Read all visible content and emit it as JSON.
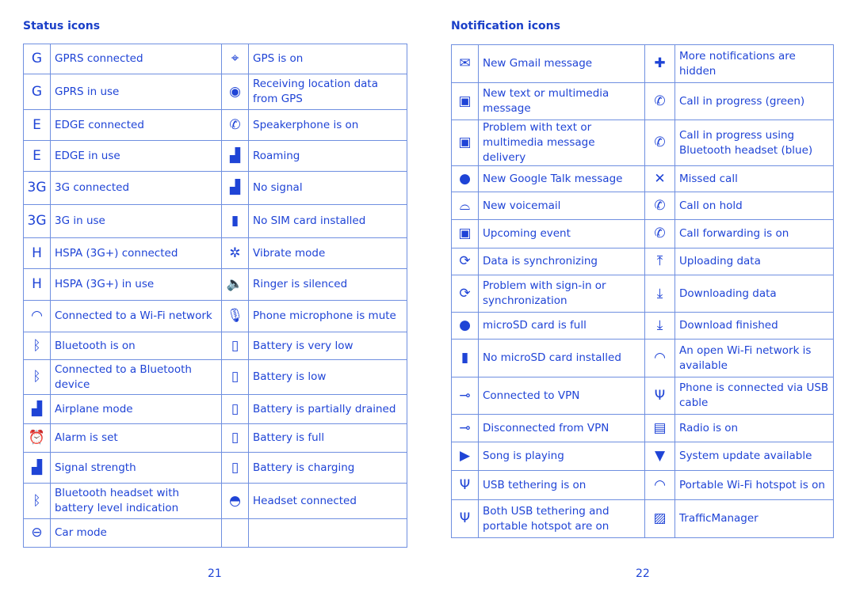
{
  "left": {
    "heading": "Status icons",
    "page": "21",
    "rows": [
      [
        {
          "icon": "gprs-connected-icon",
          "label": "GPRS connected"
        },
        {
          "icon": "gps-on-icon",
          "label": "GPS is on"
        }
      ],
      [
        {
          "icon": "gprs-in-use-icon",
          "label": "GPRS in use"
        },
        {
          "icon": "gps-receiving-icon",
          "label": "Receiving location data from GPS"
        }
      ],
      [
        {
          "icon": "edge-connected-icon",
          "label": "EDGE connected"
        },
        {
          "icon": "speakerphone-icon",
          "label": "Speakerphone is on"
        }
      ],
      [
        {
          "icon": "edge-in-use-icon",
          "label": "EDGE in use"
        },
        {
          "icon": "roaming-icon",
          "label": "Roaming"
        }
      ],
      [
        {
          "icon": "3g-connected-icon",
          "label": "3G connected"
        },
        {
          "icon": "no-signal-icon",
          "label": "No signal"
        }
      ],
      [
        {
          "icon": "3g-in-use-icon",
          "label": "3G in use"
        },
        {
          "icon": "no-sim-icon",
          "label": "No SIM card installed"
        }
      ],
      [
        {
          "icon": "hspa-connected-icon",
          "label": "HSPA (3G+) connected"
        },
        {
          "icon": "vibrate-icon",
          "label": "Vibrate mode"
        }
      ],
      [
        {
          "icon": "hspa-in-use-icon",
          "label": "HSPA (3G+) in use"
        },
        {
          "icon": "ringer-silenced-icon",
          "label": "Ringer is silenced"
        }
      ],
      [
        {
          "icon": "wifi-icon",
          "label": "Connected to a Wi-Fi network"
        },
        {
          "icon": "mic-mute-icon",
          "label": "Phone microphone is mute"
        }
      ],
      [
        {
          "icon": "bluetooth-icon",
          "label": "Bluetooth is on"
        },
        {
          "icon": "battery-very-low-icon",
          "label": "Battery is very low"
        }
      ],
      [
        {
          "icon": "bluetooth-connected-icon",
          "label": "Connected to a Bluetooth device"
        },
        {
          "icon": "battery-low-icon",
          "label": "Battery is low"
        }
      ],
      [
        {
          "icon": "airplane-mode-icon",
          "label": "Airplane mode"
        },
        {
          "icon": "battery-partial-icon",
          "label": "Battery is partially drained"
        }
      ],
      [
        {
          "icon": "alarm-icon",
          "label": "Alarm is set"
        },
        {
          "icon": "battery-full-icon",
          "label": "Battery is full"
        }
      ],
      [
        {
          "icon": "signal-strength-icon",
          "label": "Signal strength"
        },
        {
          "icon": "battery-charging-icon",
          "label": "Battery is charging"
        }
      ],
      [
        {
          "icon": "bt-headset-battery-icon",
          "label": "Bluetooth headset with battery level indication"
        },
        {
          "icon": "headset-icon",
          "label": "Headset connected"
        }
      ],
      [
        {
          "icon": "car-mode-icon",
          "label": "Car mode"
        },
        {
          "icon": "",
          "label": ""
        }
      ]
    ]
  },
  "right": {
    "heading": "Notification icons",
    "page": "22",
    "rows": [
      [
        {
          "icon": "gmail-icon",
          "label": "New Gmail message"
        },
        {
          "icon": "more-notifications-icon",
          "label": "More notifications are hidden"
        }
      ],
      [
        {
          "icon": "sms-icon",
          "label": "New text or multimedia message"
        },
        {
          "icon": "call-green-icon",
          "label": "Call in progress (green)"
        }
      ],
      [
        {
          "icon": "sms-problem-icon",
          "label": "Problem with text or multimedia message delivery"
        },
        {
          "icon": "call-bluetooth-icon",
          "label": "Call in progress using Bluetooth headset (blue)"
        }
      ],
      [
        {
          "icon": "talk-icon",
          "label": "New Google Talk message"
        },
        {
          "icon": "missed-call-icon",
          "label": "Missed call"
        }
      ],
      [
        {
          "icon": "voicemail-icon",
          "label": "New voicemail"
        },
        {
          "icon": "call-hold-icon",
          "label": "Call on hold"
        }
      ],
      [
        {
          "icon": "calendar-icon",
          "label": "Upcoming event"
        },
        {
          "icon": "call-forward-icon",
          "label": "Call forwarding is on"
        }
      ],
      [
        {
          "icon": "sync-icon",
          "label": "Data is synchronizing"
        },
        {
          "icon": "upload-icon",
          "label": "Uploading data"
        }
      ],
      [
        {
          "icon": "sync-problem-icon",
          "label": "Problem with sign-in or synchronization"
        },
        {
          "icon": "download-icon",
          "label": "Downloading data"
        }
      ],
      [
        {
          "icon": "sd-full-icon",
          "label": "microSD card is full"
        },
        {
          "icon": "download-finished-icon",
          "label": "Download finished"
        }
      ],
      [
        {
          "icon": "no-sd-icon",
          "label": "No microSD card installed"
        },
        {
          "icon": "open-wifi-icon",
          "label": "An open Wi-Fi network is available"
        }
      ],
      [
        {
          "icon": "vpn-connected-icon",
          "label": "Connected to VPN"
        },
        {
          "icon": "usb-icon",
          "label": "Phone is connected via USB cable"
        }
      ],
      [
        {
          "icon": "vpn-disconnected-icon",
          "label": "Disconnected from VPN"
        },
        {
          "icon": "radio-icon",
          "label": "Radio is on"
        }
      ],
      [
        {
          "icon": "song-playing-icon",
          "label": "Song is playing"
        },
        {
          "icon": "system-update-icon",
          "label": "System update available"
        }
      ],
      [
        {
          "icon": "usb-tethering-icon",
          "label": "USB tethering is on"
        },
        {
          "icon": "hotspot-icon",
          "label": "Portable Wi-Fi hotspot is on"
        }
      ],
      [
        {
          "icon": "usb-hotspot-icon",
          "label": "Both USB tethering and portable hotspot are on"
        },
        {
          "icon": "traffic-manager-icon",
          "label": "TrafficManager"
        }
      ]
    ]
  }
}
